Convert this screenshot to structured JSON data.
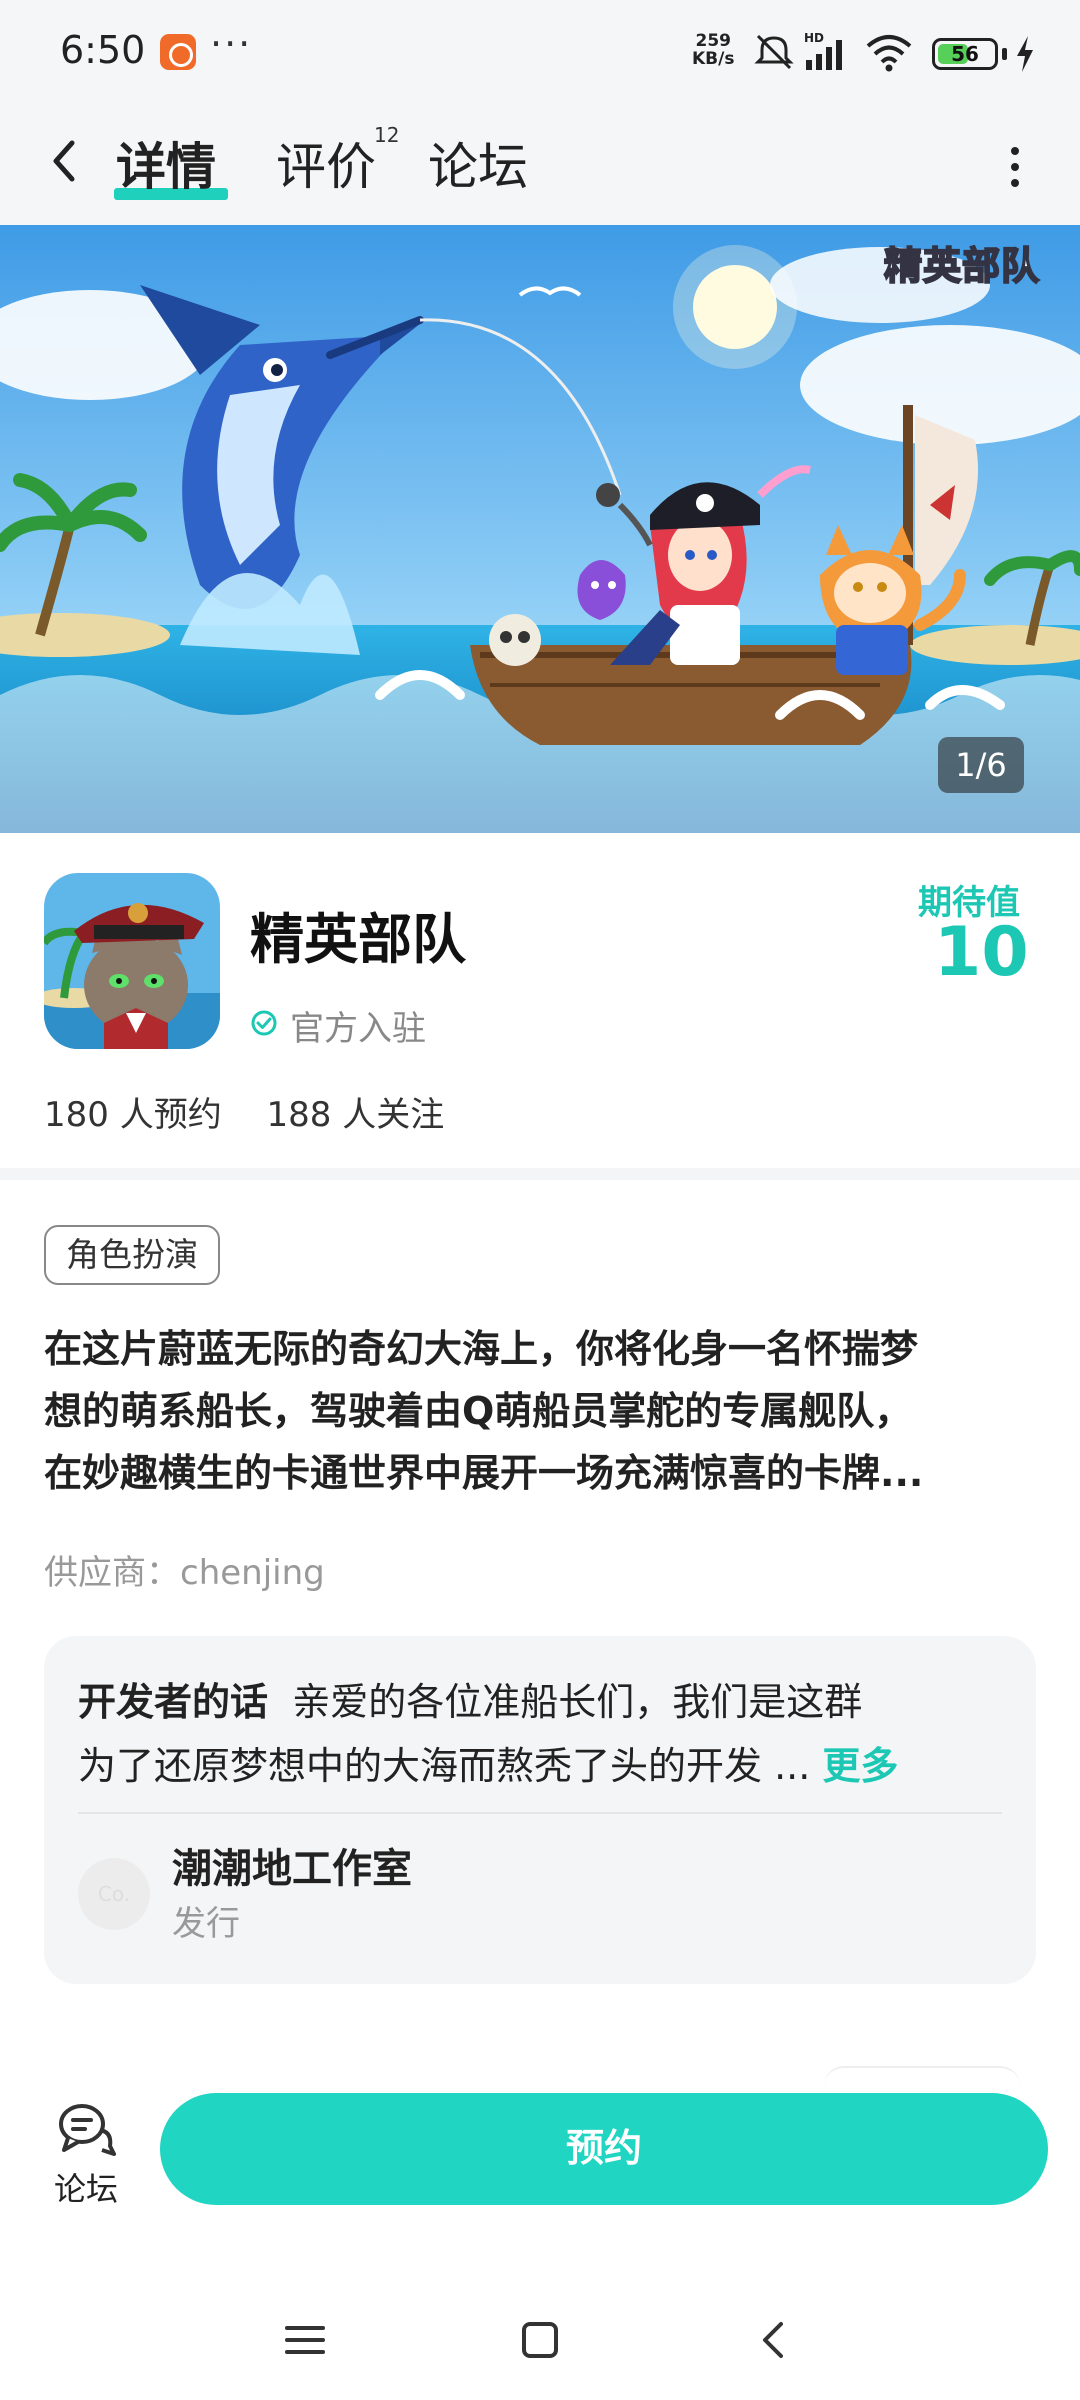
{
  "status_bar": {
    "time": "6:50",
    "dots": "···",
    "net_speed_value": "259",
    "net_speed_unit": "KB/s",
    "battery": "56",
    "battery_fraction": 0.56
  },
  "header": {
    "tabs": [
      {
        "label": "详情",
        "active": true
      },
      {
        "label": "评价",
        "count": "12"
      },
      {
        "label": "论坛"
      }
    ]
  },
  "banner": {
    "title": "精英部队",
    "counter": "1/6"
  },
  "game": {
    "name": "精英部队",
    "verified_label": "官方入驻",
    "expect_label": "期待值",
    "expect_value": "10",
    "stats": {
      "reservations": "180 人预约",
      "followers": "188 人关注"
    }
  },
  "description": {
    "tag": "角色扮演",
    "lines": [
      "在这片蔚蓝无际的奇幻大海上，你将化身一名怀揣梦",
      "想的萌系船长，驾驶着由Q萌船员掌舵的专属舰队，",
      "在妙趣横生的卡通世界中展开一场充满惊喜的卡牌..."
    ],
    "supplier": "供应商：chenjing"
  },
  "developer": {
    "label": "开发者的话",
    "line1": "亲爱的各位准船长们，我们是这群",
    "line2": "为了还原梦想中的大海而熬秃了头的开发 ...",
    "more": "更多",
    "avatar_text": "Co.",
    "studio": "潮潮地工作室",
    "role": "发行"
  },
  "action_bar": {
    "forum_label": "论坛",
    "reserve_label": "预约"
  },
  "colors": {
    "accent": "#1cc7b4",
    "button": "#20d5c2"
  }
}
